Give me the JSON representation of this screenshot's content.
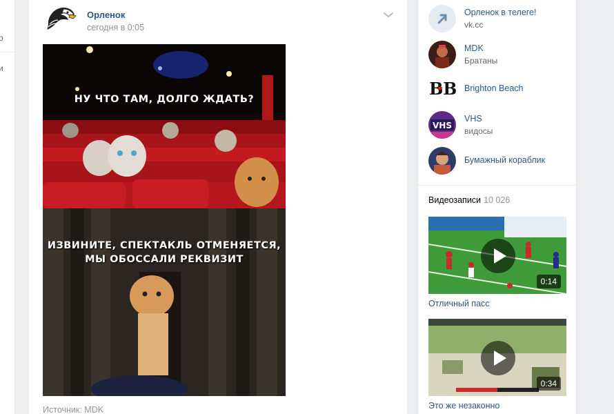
{
  "left_fragments": [
    "о",
    "и"
  ],
  "post": {
    "author": "Орленок",
    "date": "сегодня в 0:05",
    "meme_top_text": "НУ ЧТО ТАМ, ДОЛГО ЖДАТЬ?",
    "meme_bottom_line1": "ИЗВИНИТЕ, СПЕКТАКЛЬ ОТМЕНЯЕТСЯ,",
    "meme_bottom_line2": "МЫ ОБОССАЛИ РЕКВИЗИТ",
    "source_label": "Источник: MDK"
  },
  "links": [
    {
      "title": "Орленок в телеге!",
      "subtitle": "vk.cc",
      "icon": "share-arrow-icon"
    },
    {
      "title": "MDK",
      "subtitle": "Братаны",
      "icon": "mdk-avatar"
    },
    {
      "title": "Brighton Beach",
      "subtitle": "",
      "icon": "brighton-beach-logo"
    },
    {
      "title": "VHS",
      "subtitle": "видосы",
      "icon": "vhs-avatar"
    },
    {
      "title": "Бумажный кораблик",
      "subtitle": "",
      "icon": "paper-boat-avatar"
    }
  ],
  "videos": {
    "title": "Видеозаписи",
    "count": "10 026",
    "items": [
      {
        "duration": "0:14",
        "caption": "Отличный пасс"
      },
      {
        "duration": "0:34",
        "caption": "Это же незаконно"
      }
    ]
  },
  "colors": {
    "link": "#2a5885",
    "muted": "#939393",
    "background": "#edeef0",
    "card": "#ffffff"
  }
}
